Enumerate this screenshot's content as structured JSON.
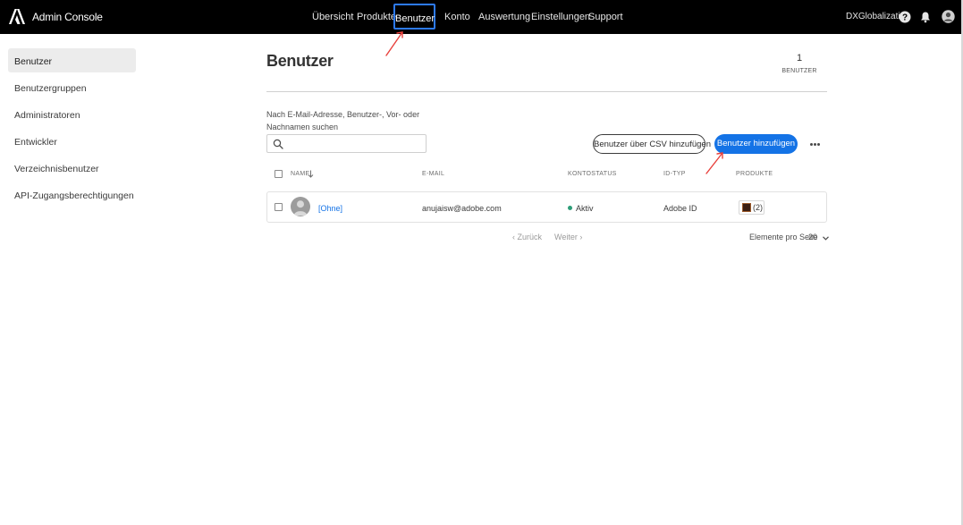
{
  "app": {
    "title": "Admin Console",
    "logo": "adobe-logo"
  },
  "nav": {
    "items": [
      {
        "label": "Übersicht"
      },
      {
        "label": "Produkte"
      },
      {
        "label": "Benutzer",
        "active": true
      },
      {
        "label": "Konto"
      },
      {
        "label": "Auswertung"
      },
      {
        "label": "Einstellungen"
      },
      {
        "label": "Support"
      }
    ],
    "org_name": "DXGlobalization",
    "icons": [
      "help-icon",
      "bell-icon",
      "user-avatar-icon"
    ]
  },
  "sidebar": {
    "items": [
      {
        "label": "Benutzer",
        "active": true
      },
      {
        "label": "Benutzergruppen"
      },
      {
        "label": "Administratoren"
      },
      {
        "label": "Entwickler"
      },
      {
        "label": "Verzeichnisbenutzer"
      },
      {
        "label": "API-Zugangsberechtigungen"
      }
    ]
  },
  "main": {
    "title": "Benutzer",
    "count": {
      "value": "1",
      "label": "BENUTZER"
    },
    "search": {
      "label": "Nach E-Mail-Adresse, Benutzer-, Vor- oder Nachnamen suchen",
      "value": "",
      "placeholder": ""
    },
    "buttons": {
      "csv": "Benutzer über CSV hinzufügen",
      "add": "Benutzer hinzufügen"
    },
    "table": {
      "columns": [
        "NAME",
        "E-MAIL",
        "KONTOSTATUS",
        "ID-TYP",
        "PRODUKTE"
      ],
      "rows": [
        {
          "name": "[Ohne]",
          "email": "anujaisw@adobe.com",
          "status": "Aktiv",
          "id_type": "Adobe ID",
          "products": "(2)"
        }
      ]
    },
    "pagination": {
      "prev": "Zurück",
      "next": "Weiter",
      "per_page_label": "Elemente pro Seite",
      "per_page_value": "20"
    }
  },
  "colors": {
    "topbar": "#000000",
    "accent": "#1473e6",
    "active_nav_outline": "#2d7af5",
    "status_active": "#2d9d78",
    "annotation_arrow": "#e8413c"
  }
}
